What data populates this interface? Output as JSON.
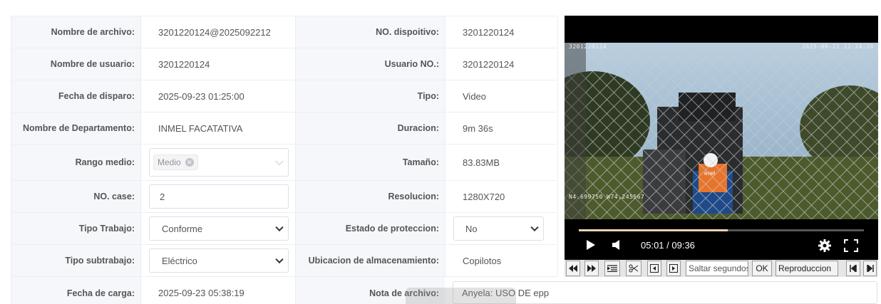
{
  "fields": {
    "r1": {
      "l1": "Nombre de archivo:",
      "v1": "3201220124@2025092212",
      "l2": "NO. dispoitivo:",
      "v2": "3201220124"
    },
    "r2": {
      "l1": "Nombre de usuario:",
      "v1": "3201220124",
      "l2": "Usuario NO.:",
      "v2": "3201220124"
    },
    "r3": {
      "l1": "Fecha de disparo:",
      "v1": "2025-09-23 01:25:00",
      "l2": "Tipo:",
      "v2": "Video"
    },
    "r4": {
      "l1": "Nombre de Departamento:",
      "v1": "INMEL FACATATIVA",
      "l2": "Duracion:",
      "v2": "9m 36s"
    },
    "r5": {
      "l1": "Rango medio:",
      "tag": "Medio",
      "l2": "Tamaño:",
      "v2": "83.83MB"
    },
    "r6": {
      "l1": "NO. case:",
      "input": "2",
      "l2": "Resolucion:",
      "v2": "1280X720"
    },
    "r7": {
      "l1": "Tipo Trabajo:",
      "select": "Conforme",
      "l2": "Estado de proteccion:",
      "select2": "No"
    },
    "r8": {
      "l1": "Tipo subtrabajo:",
      "select": "Eléctrico",
      "l2": "Ubicacion de almacenamiento:",
      "v2": "Copilotos"
    },
    "r9": {
      "l1": "Fecha de carga:",
      "v1": "2025-09-23 05:38:19",
      "l2": "Nota de archivo:",
      "note": "Anyela: USO DE epp"
    }
  },
  "video": {
    "osd_id": "3201220124",
    "osd_datetime": "2025-09-22 12:24:26",
    "osd_gps": "N4.699750  W74.245567",
    "vest_text": "enel",
    "time": "05:01 / 09:36",
    "progress": 0.522
  },
  "toolbar": {
    "seek_placeholder": "Saltar segundos",
    "ok": "OK",
    "playback": "Reproduccion"
  },
  "colors": {
    "label_bg": "#f5f7fa",
    "border": "#ebeef5",
    "accent_vest": "#e8742b"
  }
}
